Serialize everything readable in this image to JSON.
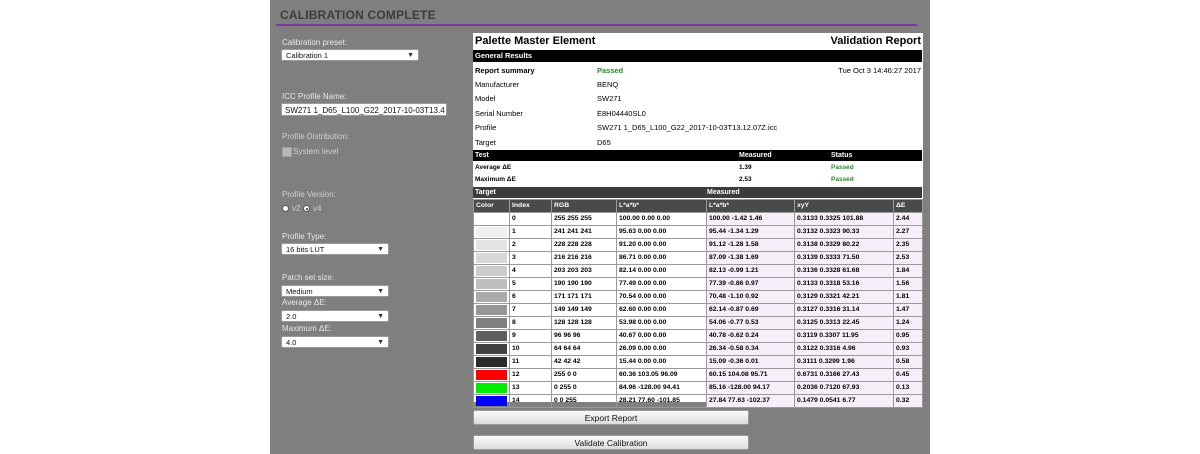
{
  "title": "CALIBRATION COMPLETE",
  "form": {
    "preset_label": "Calibration preset:",
    "preset_value": "Calibration 1",
    "icc_label": "ICC Profile Name:",
    "icc_value": "SW271 1_D65_L100_G22_2017-10-03T13.4",
    "distribution_label": "Profile Distribution:",
    "system_level_label": "System level",
    "version_label": "Profile Version:",
    "v2_label": "v2",
    "v4_label": "v4",
    "selected_version": "v4",
    "type_label": "Profile Type:",
    "type_value": "16 bits LUT",
    "patch_label": "Patch set size:",
    "patch_value": "Medium",
    "avg_label": "Average ΔE:",
    "avg_value": "2.0",
    "max_label": "Maximum ΔE:",
    "max_value": "4.0"
  },
  "report": {
    "app_name": "Palette Master Element",
    "report_title": "Validation Report",
    "general_results": "General Results",
    "summary_label": "Report summary",
    "summary_status": "Passed",
    "date": "Tue Oct 3 14:46:27 2017",
    "info": [
      {
        "label": "Manufacturer",
        "value": "BENQ"
      },
      {
        "label": "Model",
        "value": "SW271"
      },
      {
        "label": "Serial Number",
        "value": "E8H04440SL0"
      },
      {
        "label": "Profile",
        "value": "SW271 1_D65_L100_G22_2017-10-03T13.12.07Z.icc"
      },
      {
        "label": "Target",
        "value": "D65"
      }
    ],
    "test_header": {
      "test": "Test",
      "measured": "Measured",
      "status": "Status"
    },
    "tests": [
      {
        "name": "Average ΔE",
        "measured": "1.39",
        "status": "Passed"
      },
      {
        "name": "Maximum ΔE",
        "measured": "2.53",
        "status": "Passed"
      }
    ],
    "group_headers": {
      "target": "Target",
      "measured": "Measured"
    },
    "columns": [
      "Color",
      "Index",
      "RGB",
      "L*a*b*",
      "L*a*b*",
      "xyY",
      "ΔE"
    ],
    "rows": [
      {
        "color": "#ffffff",
        "index": "0",
        "rgb": "255  255  255",
        "lab_t": "100.00  0.00  0.00",
        "lab_m": "100.00  -1.42  1.46",
        "xyy": "0.3133  0.3325  101.88",
        "de": "2.44"
      },
      {
        "color": "#f1f1f1",
        "index": "1",
        "rgb": "241  241  241",
        "lab_t": "95.63  0.00  0.00",
        "lab_m": "95.44  -1.34  1.29",
        "xyy": "0.3132  0.3323  90.33",
        "de": "2.27"
      },
      {
        "color": "#e4e4e4",
        "index": "2",
        "rgb": "228  228  228",
        "lab_t": "91.20  0.00  0.00",
        "lab_m": "91.12  -1.28  1.58",
        "xyy": "0.3138  0.3329  80.22",
        "de": "2.35"
      },
      {
        "color": "#d8d8d8",
        "index": "3",
        "rgb": "216  216  216",
        "lab_t": "86.71  0.00  0.00",
        "lab_m": "87.09  -1.38  1.69",
        "xyy": "0.3139  0.3333  71.50",
        "de": "2.53"
      },
      {
        "color": "#cbcbcb",
        "index": "4",
        "rgb": "203  203  203",
        "lab_t": "82.14  0.00  0.00",
        "lab_m": "82.13  -0.99  1.21",
        "xyy": "0.3136  0.3328  61.68",
        "de": "1.84"
      },
      {
        "color": "#bebebe",
        "index": "5",
        "rgb": "190  190  190",
        "lab_t": "77.49  0.00  0.00",
        "lab_m": "77.39  -0.86  0.97",
        "xyy": "0.3133  0.3318  53.16",
        "de": "1.56"
      },
      {
        "color": "#ababab",
        "index": "6",
        "rgb": "171  171  171",
        "lab_t": "70.54  0.00  0.00",
        "lab_m": "70.48  -1.10  0.92",
        "xyy": "0.3129  0.3321  42.21",
        "de": "1.81"
      },
      {
        "color": "#959595",
        "index": "7",
        "rgb": "149  149  149",
        "lab_t": "62.60  0.00  0.00",
        "lab_m": "62.14  -0.87  0.69",
        "xyy": "0.3127  0.3316  31.14",
        "de": "1.47"
      },
      {
        "color": "#808080",
        "index": "8",
        "rgb": "128  128  128",
        "lab_t": "53.98  0.00  0.00",
        "lab_m": "54.06  -0.77  0.53",
        "xyy": "0.3125  0.3313  22.45",
        "de": "1.24"
      },
      {
        "color": "#606060",
        "index": "9",
        "rgb": "96  96  96",
        "lab_t": "40.67  0.00  0.00",
        "lab_m": "40.78  -0.62  0.24",
        "xyy": "0.3119  0.3307  11.95",
        "de": "0.95"
      },
      {
        "color": "#404040",
        "index": "10",
        "rgb": "64  64  64",
        "lab_t": "26.09  0.00  0.00",
        "lab_m": "26.34  -0.58  0.34",
        "xyy": "0.3122  0.3316  4.96",
        "de": "0.93"
      },
      {
        "color": "#2a2a2a",
        "index": "11",
        "rgb": "42  42  42",
        "lab_t": "15.44  0.00  0.00",
        "lab_m": "15.09  -0.36  0.01",
        "xyy": "0.3111  0.3299  1.96",
        "de": "0.58"
      },
      {
        "color": "#ff0000",
        "index": "12",
        "rgb": "255  0  0",
        "lab_t": "60.36  103.05  96.09",
        "lab_m": "60.15  104.08  95.71",
        "xyy": "0.6731  0.3166  27.43",
        "de": "0.45"
      },
      {
        "color": "#00ee00",
        "index": "13",
        "rgb": "0  255  0",
        "lab_t": "84.96  -128.00  94.41",
        "lab_m": "85.16  -128.00  94.17",
        "xyy": "0.2036  0.7120  67.93",
        "de": "0.13"
      },
      {
        "color": "#0000ff",
        "index": "14",
        "rgb": "0  0  255",
        "lab_t": "28.21  77.60  -101.85",
        "lab_m": "27.84  77.63  -102.37",
        "xyy": "0.1479  0.0541  6.77",
        "de": "0.32"
      }
    ]
  },
  "buttons": {
    "export": "Export Report",
    "validate": "Validate Calibration"
  }
}
